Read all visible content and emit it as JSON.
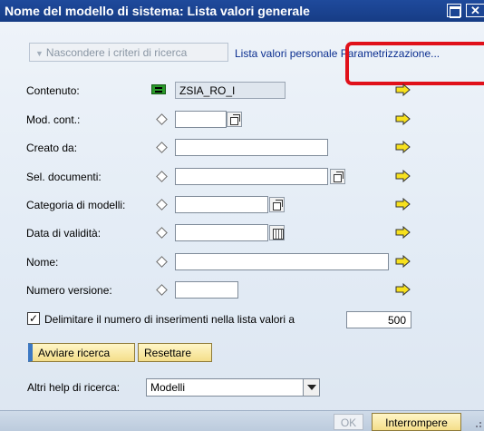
{
  "window": {
    "title": "Nome del modello di sistema: Lista valori generale",
    "minimize_icon": "minimize-icon",
    "close_glyph": "✕"
  },
  "toolbar": {
    "hide_criteria_label": "Nascondere i criteri di ricerca",
    "personal_list_link": "Lista valori personale",
    "parametrization_link": "Parametrizzazione...",
    "highlight_color": "#e0101a"
  },
  "form": {
    "rows": [
      {
        "label": "Contenuto:",
        "option": "equals-icon",
        "value": "ZSIA_RO_I",
        "readonly": true
      },
      {
        "label": "Mod. cont.:",
        "option": "diamond-icon",
        "value": "",
        "help": "f4-help-icon"
      },
      {
        "label": "Creato da:",
        "option": "diamond-icon",
        "value": ""
      },
      {
        "label": "Sel. documenti:",
        "option": "diamond-icon",
        "value": "",
        "help": "f4-help-icon"
      },
      {
        "label": "Categoria di modelli:",
        "option": "diamond-icon",
        "value": "",
        "help": "f4-help-icon"
      },
      {
        "label": "Data di validità:",
        "option": "diamond-icon",
        "value": "",
        "help": "calendar-icon"
      },
      {
        "label": "Nome:",
        "option": "diamond-icon",
        "value": ""
      },
      {
        "label": "Numero versione:",
        "option": "diamond-icon",
        "value": ""
      }
    ],
    "multiple_selection_icon": "yellow-arrow-icon"
  },
  "limit": {
    "checked": true,
    "label": "Delimitare il numero di inserimenti nella lista valori a",
    "value": "500"
  },
  "actions": {
    "start_search": "Avviare ricerca",
    "reset": "Resettare"
  },
  "other_help": {
    "label": "Altri help di ricerca:",
    "selected": "Modelli"
  },
  "footer": {
    "ok": "OK",
    "cancel": "Interrompere"
  }
}
